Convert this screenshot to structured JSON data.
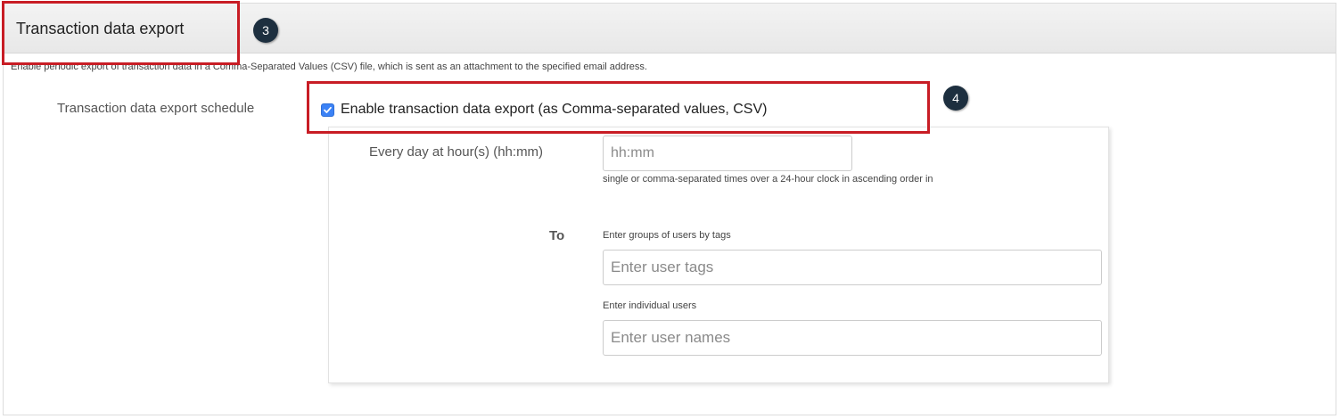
{
  "section": {
    "title": "Transaction data export",
    "description": "Enable periodic export of transaction data in a Comma-Separated Values (CSV) file, which is sent as an attachment to the specified email address."
  },
  "schedule": {
    "label": "Transaction data export schedule",
    "enable_checkbox": {
      "label": "Enable transaction data export (as Comma-separated values, CSV)",
      "checked": true
    },
    "time": {
      "label": "Every day at hour(s) (hh:mm)",
      "placeholder": "hh:mm",
      "value": "",
      "help": "single or comma-separated times over a 24-hour clock in ascending order in"
    },
    "recipients": {
      "label": "To",
      "tags_caption": "Enter groups of users by tags",
      "tags_placeholder": "Enter user tags",
      "users_caption": "Enter individual users",
      "users_placeholder": "Enter user names"
    }
  },
  "annotations": {
    "callout_1": "3",
    "callout_2": "4",
    "highlight_color": "#c81d25",
    "callout_color": "#1d2f3f"
  },
  "colors": {
    "checkbox": "#3b82f6",
    "header_bg": "#ececec"
  }
}
